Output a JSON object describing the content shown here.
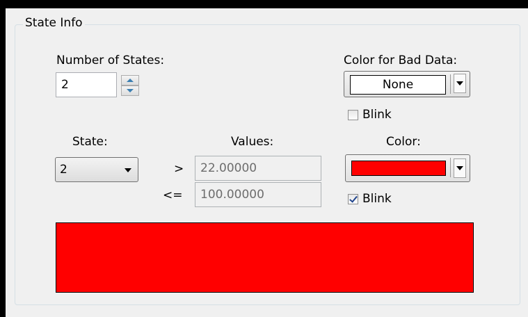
{
  "group": {
    "title": "State Info"
  },
  "num_states": {
    "label": "Number of States:",
    "value": "2"
  },
  "bad_data": {
    "label": "Color for Bad Data:",
    "color_value": "None",
    "blink_label": "Blink",
    "blink_checked": false
  },
  "state": {
    "label": "State:",
    "selected": "2"
  },
  "values": {
    "label": "Values:",
    "gt_op": ">",
    "gt_value": "22.00000",
    "le_op": "<=",
    "le_value": "100.00000"
  },
  "state_color": {
    "label": "Color:",
    "swatch": "#ff0000",
    "blink_label": "Blink",
    "blink_checked": true
  },
  "preview": {
    "color": "#ff0000"
  }
}
